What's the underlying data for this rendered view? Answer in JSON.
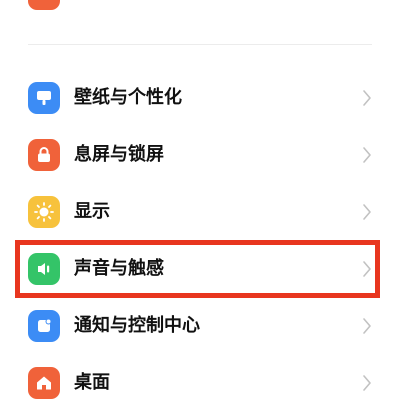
{
  "settings": {
    "items": [
      {
        "label": "壁纸与个性化",
        "icon": "wallpaper-icon",
        "color": "#3c8cf5"
      },
      {
        "label": "息屏与锁屏",
        "icon": "lock-icon",
        "color": "#f0623a"
      },
      {
        "label": "显示",
        "icon": "sun-icon",
        "color": "#f7c23c"
      },
      {
        "label": "声音与触感",
        "icon": "speaker-icon",
        "color": "#34c468"
      },
      {
        "label": "通知与控制中心",
        "icon": "notification-icon",
        "color": "#3c8cf5"
      },
      {
        "label": "桌面",
        "icon": "home-icon",
        "color": "#f0623a"
      }
    ]
  },
  "colors": {
    "highlight": "#e8361f",
    "top_partial_icon": "#f0623a"
  }
}
